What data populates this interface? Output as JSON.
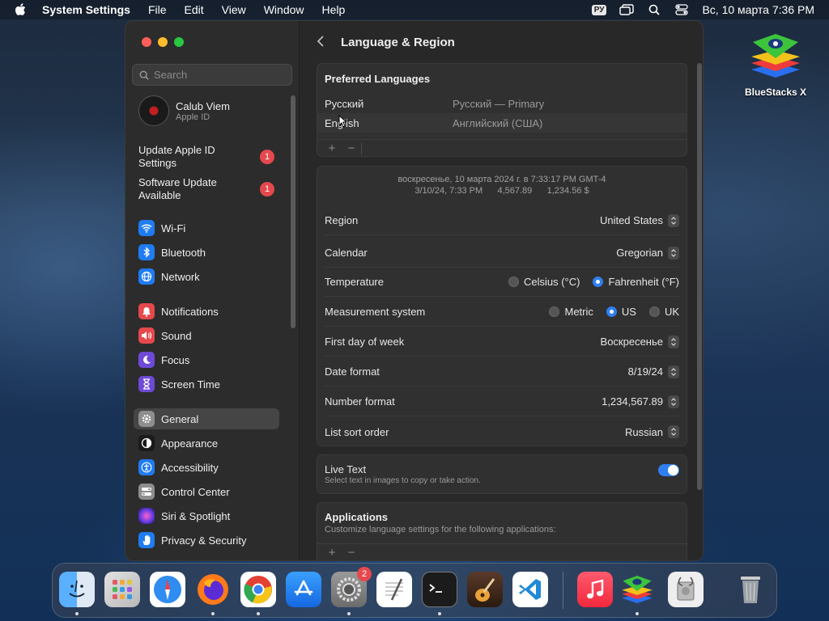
{
  "menubar": {
    "app_name": "System Settings",
    "menus": [
      "File",
      "Edit",
      "View",
      "Window",
      "Help"
    ],
    "input_source": "РУ",
    "datetime": "Вс, 10 марта  7:36 PM"
  },
  "desktop": {
    "icon_label": "BlueStacks X"
  },
  "sidebar": {
    "search_placeholder": "Search",
    "account_name": "Calub Viem",
    "account_sub": "Apple ID",
    "alerts": [
      {
        "label": "Update Apple ID Settings",
        "count": "1"
      },
      {
        "label": "Software Update Available",
        "count": "1"
      }
    ],
    "items": [
      {
        "label": "Wi-Fi",
        "icon": "wifi-icon",
        "color": "#1f7cf2"
      },
      {
        "label": "Bluetooth",
        "icon": "bluetooth-icon",
        "color": "#1f7cf2"
      },
      {
        "label": "Network",
        "icon": "globe-icon",
        "color": "#1f7cf2"
      },
      {
        "label": "Notifications",
        "icon": "bell-icon",
        "color": "#e5484d"
      },
      {
        "label": "Sound",
        "icon": "speaker-icon",
        "color": "#e5484d"
      },
      {
        "label": "Focus",
        "icon": "moon-icon",
        "color": "#6e4ad6"
      },
      {
        "label": "Screen Time",
        "icon": "hourglass-icon",
        "color": "#6e4ad6"
      },
      {
        "label": "General",
        "icon": "gear-icon",
        "color": "#8e8e8e"
      },
      {
        "label": "Appearance",
        "icon": "appearance-icon",
        "color": "#1a1a1a"
      },
      {
        "label": "Accessibility",
        "icon": "accessibility-icon",
        "color": "#1f7cf2"
      },
      {
        "label": "Control Center",
        "icon": "toggles-icon",
        "color": "#8e8e8e"
      },
      {
        "label": "Siri & Spotlight",
        "icon": "siri-icon",
        "color": "#c94ad6"
      },
      {
        "label": "Privacy & Security",
        "icon": "hand-icon",
        "color": "#1f7cf2"
      }
    ],
    "active": "General"
  },
  "content": {
    "title": "Language & Region",
    "preferred_languages": {
      "title": "Preferred Languages",
      "rows": [
        {
          "name": "Русский",
          "detail": "Русский — Primary"
        },
        {
          "name": "English",
          "detail": "Английский (США)"
        }
      ],
      "add": "+",
      "remove": "−"
    },
    "format_sample": {
      "line1": "воскресенье, 10 марта 2024 г. в 7:33:17 PM GMT-4",
      "line2": "3/10/24, 7:33 PM      4,567.89      1,234.56 $"
    },
    "settings": {
      "region_label": "Region",
      "region_value": "United States",
      "calendar_label": "Calendar",
      "calendar_value": "Gregorian",
      "temperature_label": "Temperature",
      "temp_celsius": "Celsius (°C)",
      "temp_fahrenheit": "Fahrenheit (°F)",
      "measurement_label": "Measurement system",
      "meas_metric": "Metric",
      "meas_us": "US",
      "meas_uk": "UK",
      "firstday_label": "First day of week",
      "firstday_value": "Воскресенье",
      "dateformat_label": "Date format",
      "dateformat_value": "8/19/24",
      "numberformat_label": "Number format",
      "numberformat_value": "1,234,567.89",
      "sort_label": "List sort order",
      "sort_value": "Russian"
    },
    "live_text": {
      "title": "Live Text",
      "sub": "Select text in images to copy or take action."
    },
    "applications": {
      "title": "Applications",
      "sub": "Customize language settings for the following applications:"
    }
  },
  "dock": {
    "settings_badge": "2"
  },
  "colors": {
    "accent": "#2f7ff0",
    "badge": "#e5484d",
    "close": "#ff5f57",
    "minimize": "#febc2e",
    "zoom": "#28c840"
  }
}
